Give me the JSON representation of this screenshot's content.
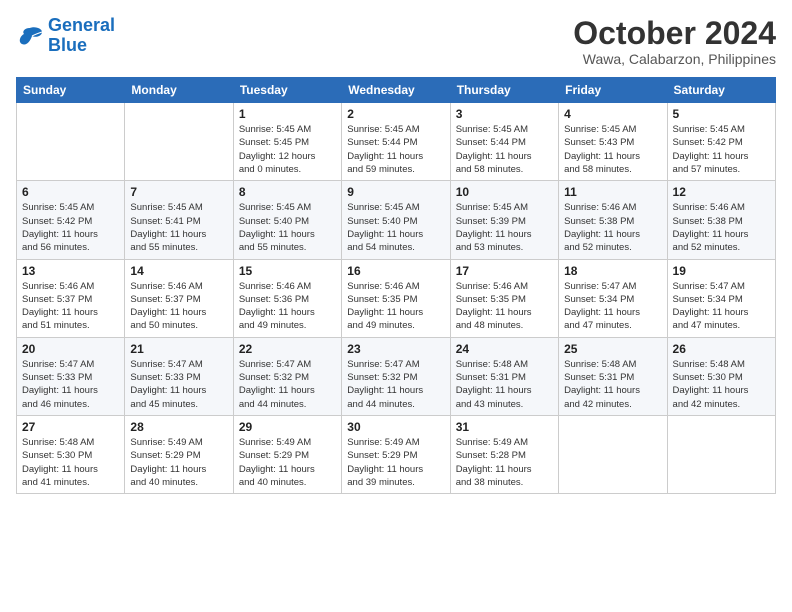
{
  "logo": {
    "line1": "General",
    "line2": "Blue"
  },
  "title": "October 2024",
  "location": "Wawa, Calabarzon, Philippines",
  "days_header": [
    "Sunday",
    "Monday",
    "Tuesday",
    "Wednesday",
    "Thursday",
    "Friday",
    "Saturday"
  ],
  "weeks": [
    [
      {
        "num": "",
        "info": ""
      },
      {
        "num": "",
        "info": ""
      },
      {
        "num": "1",
        "info": "Sunrise: 5:45 AM\nSunset: 5:45 PM\nDaylight: 12 hours\nand 0 minutes."
      },
      {
        "num": "2",
        "info": "Sunrise: 5:45 AM\nSunset: 5:44 PM\nDaylight: 11 hours\nand 59 minutes."
      },
      {
        "num": "3",
        "info": "Sunrise: 5:45 AM\nSunset: 5:44 PM\nDaylight: 11 hours\nand 58 minutes."
      },
      {
        "num": "4",
        "info": "Sunrise: 5:45 AM\nSunset: 5:43 PM\nDaylight: 11 hours\nand 58 minutes."
      },
      {
        "num": "5",
        "info": "Sunrise: 5:45 AM\nSunset: 5:42 PM\nDaylight: 11 hours\nand 57 minutes."
      }
    ],
    [
      {
        "num": "6",
        "info": "Sunrise: 5:45 AM\nSunset: 5:42 PM\nDaylight: 11 hours\nand 56 minutes."
      },
      {
        "num": "7",
        "info": "Sunrise: 5:45 AM\nSunset: 5:41 PM\nDaylight: 11 hours\nand 55 minutes."
      },
      {
        "num": "8",
        "info": "Sunrise: 5:45 AM\nSunset: 5:40 PM\nDaylight: 11 hours\nand 55 minutes."
      },
      {
        "num": "9",
        "info": "Sunrise: 5:45 AM\nSunset: 5:40 PM\nDaylight: 11 hours\nand 54 minutes."
      },
      {
        "num": "10",
        "info": "Sunrise: 5:45 AM\nSunset: 5:39 PM\nDaylight: 11 hours\nand 53 minutes."
      },
      {
        "num": "11",
        "info": "Sunrise: 5:46 AM\nSunset: 5:38 PM\nDaylight: 11 hours\nand 52 minutes."
      },
      {
        "num": "12",
        "info": "Sunrise: 5:46 AM\nSunset: 5:38 PM\nDaylight: 11 hours\nand 52 minutes."
      }
    ],
    [
      {
        "num": "13",
        "info": "Sunrise: 5:46 AM\nSunset: 5:37 PM\nDaylight: 11 hours\nand 51 minutes."
      },
      {
        "num": "14",
        "info": "Sunrise: 5:46 AM\nSunset: 5:37 PM\nDaylight: 11 hours\nand 50 minutes."
      },
      {
        "num": "15",
        "info": "Sunrise: 5:46 AM\nSunset: 5:36 PM\nDaylight: 11 hours\nand 49 minutes."
      },
      {
        "num": "16",
        "info": "Sunrise: 5:46 AM\nSunset: 5:35 PM\nDaylight: 11 hours\nand 49 minutes."
      },
      {
        "num": "17",
        "info": "Sunrise: 5:46 AM\nSunset: 5:35 PM\nDaylight: 11 hours\nand 48 minutes."
      },
      {
        "num": "18",
        "info": "Sunrise: 5:47 AM\nSunset: 5:34 PM\nDaylight: 11 hours\nand 47 minutes."
      },
      {
        "num": "19",
        "info": "Sunrise: 5:47 AM\nSunset: 5:34 PM\nDaylight: 11 hours\nand 47 minutes."
      }
    ],
    [
      {
        "num": "20",
        "info": "Sunrise: 5:47 AM\nSunset: 5:33 PM\nDaylight: 11 hours\nand 46 minutes."
      },
      {
        "num": "21",
        "info": "Sunrise: 5:47 AM\nSunset: 5:33 PM\nDaylight: 11 hours\nand 45 minutes."
      },
      {
        "num": "22",
        "info": "Sunrise: 5:47 AM\nSunset: 5:32 PM\nDaylight: 11 hours\nand 44 minutes."
      },
      {
        "num": "23",
        "info": "Sunrise: 5:47 AM\nSunset: 5:32 PM\nDaylight: 11 hours\nand 44 minutes."
      },
      {
        "num": "24",
        "info": "Sunrise: 5:48 AM\nSunset: 5:31 PM\nDaylight: 11 hours\nand 43 minutes."
      },
      {
        "num": "25",
        "info": "Sunrise: 5:48 AM\nSunset: 5:31 PM\nDaylight: 11 hours\nand 42 minutes."
      },
      {
        "num": "26",
        "info": "Sunrise: 5:48 AM\nSunset: 5:30 PM\nDaylight: 11 hours\nand 42 minutes."
      }
    ],
    [
      {
        "num": "27",
        "info": "Sunrise: 5:48 AM\nSunset: 5:30 PM\nDaylight: 11 hours\nand 41 minutes."
      },
      {
        "num": "28",
        "info": "Sunrise: 5:49 AM\nSunset: 5:29 PM\nDaylight: 11 hours\nand 40 minutes."
      },
      {
        "num": "29",
        "info": "Sunrise: 5:49 AM\nSunset: 5:29 PM\nDaylight: 11 hours\nand 40 minutes."
      },
      {
        "num": "30",
        "info": "Sunrise: 5:49 AM\nSunset: 5:29 PM\nDaylight: 11 hours\nand 39 minutes."
      },
      {
        "num": "31",
        "info": "Sunrise: 5:49 AM\nSunset: 5:28 PM\nDaylight: 11 hours\nand 38 minutes."
      },
      {
        "num": "",
        "info": ""
      },
      {
        "num": "",
        "info": ""
      }
    ]
  ]
}
